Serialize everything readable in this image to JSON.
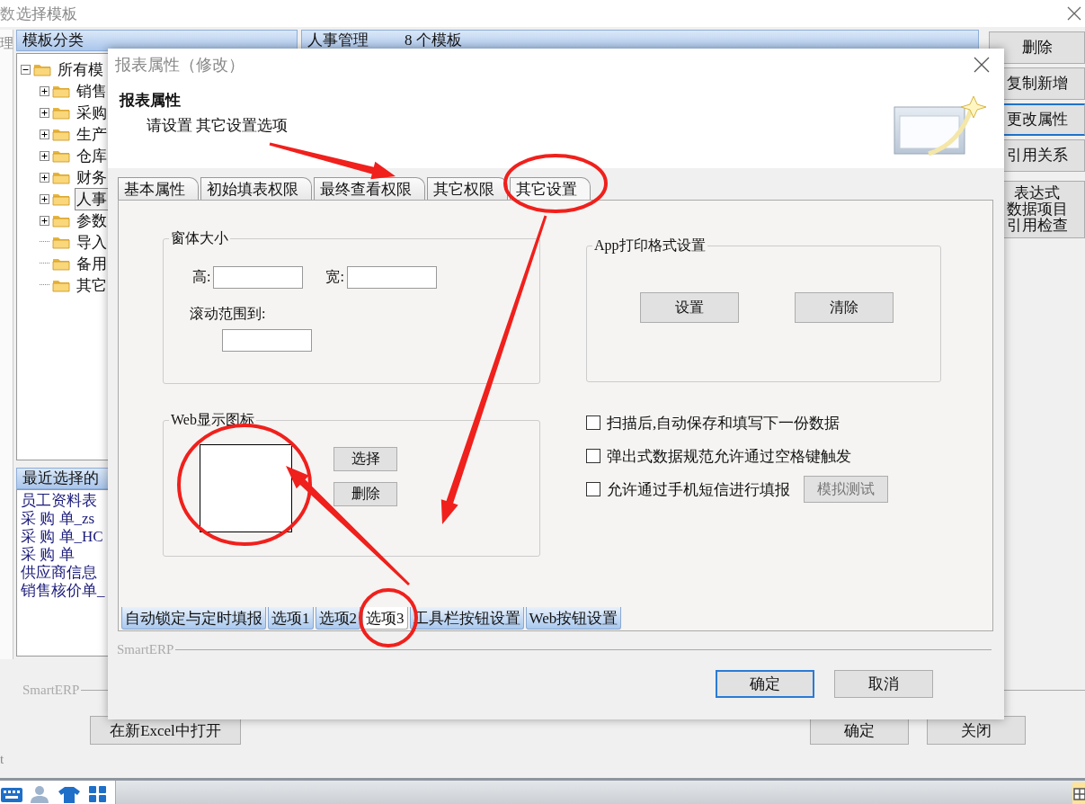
{
  "main_window": {
    "title": "选择模板",
    "edge_texts": [
      "数",
      "理",
      "t"
    ],
    "category_panel": {
      "title": "模板分类",
      "tree": {
        "label": "所有模",
        "expanded": true,
        "children": [
          {
            "label": "销售",
            "expandable": true,
            "selected": false
          },
          {
            "label": "采购",
            "expandable": true,
            "selected": false
          },
          {
            "label": "生产",
            "expandable": true,
            "selected": false
          },
          {
            "label": "仓库",
            "expandable": true,
            "selected": false
          },
          {
            "label": "财务",
            "expandable": true,
            "selected": false
          },
          {
            "label": "人事",
            "expandable": true,
            "selected": true
          },
          {
            "label": "参数",
            "expandable": true,
            "selected": false
          },
          {
            "label": "导入",
            "expandable": false,
            "selected": false
          },
          {
            "label": "备用",
            "expandable": false,
            "selected": false
          },
          {
            "label": "其它",
            "expandable": false,
            "selected": false
          }
        ]
      }
    },
    "recent_panel": {
      "title": "最近选择的",
      "items": [
        "员工资料表",
        "采 购 单_zs",
        "采 购 单_HC",
        "采 购 单",
        "供应商信息",
        "销售核价单_"
      ]
    },
    "template_header": {
      "category": "人事管理",
      "count": "8 个模板"
    },
    "side_buttons": [
      {
        "label": "删除",
        "selected": false
      },
      {
        "label": "复制新增",
        "selected": false
      },
      {
        "label": "更改属性",
        "selected": true
      },
      {
        "label": "引用关系",
        "selected": false
      },
      {
        "lines": [
          "表达式",
          "数据项目",
          "引用检查"
        ],
        "selected": false
      }
    ],
    "brand": "SmartERP",
    "open_excel_button": "在新Excel中打开",
    "buttons": [
      "确定",
      "关闭"
    ]
  },
  "dialog": {
    "title": "报表属性（修改）",
    "heading": "报表属性",
    "subheading": "请设置 其它设置选项",
    "tabs": [
      {
        "label": "基本属性",
        "selected": false
      },
      {
        "label": "初始填表权限",
        "selected": false
      },
      {
        "label": "最终查看权限",
        "selected": false
      },
      {
        "label": "其它权限",
        "selected": false
      },
      {
        "label": "其它设置",
        "selected": true
      }
    ],
    "size_group": {
      "title": "窗体大小",
      "height_label": "高:",
      "width_label": "宽:",
      "scroll_label": "滚动范围到:"
    },
    "app_print_group": {
      "title": "App打印格式设置",
      "buttons": [
        "设置",
        "清除"
      ]
    },
    "web_icon_group": {
      "title": "Web显示图标",
      "buttons": [
        "选择",
        "删除"
      ]
    },
    "options": [
      {
        "label": "扫描后,自动保存和填写下一份数据",
        "checked": false
      },
      {
        "label": "弹出式数据规范允许通过空格键触发",
        "checked": false
      },
      {
        "label": "允许通过手机短信进行填报",
        "checked": false,
        "button": {
          "label": "模拟测试",
          "disabled": true
        }
      }
    ],
    "bottom_tabs": [
      {
        "label": "自动锁定与定时填报",
        "selected": false
      },
      {
        "label": "选项1",
        "selected": false
      },
      {
        "label": "选项2",
        "selected": false
      },
      {
        "label": "选项3",
        "selected": true
      },
      {
        "label": "工具栏按钮设置",
        "selected": false
      },
      {
        "label": "Web按钮设置",
        "selected": false
      }
    ],
    "brand": "SmartERP",
    "buttons": [
      {
        "label": "确定",
        "focused": true
      },
      {
        "label": "取消",
        "focused": false
      }
    ]
  }
}
